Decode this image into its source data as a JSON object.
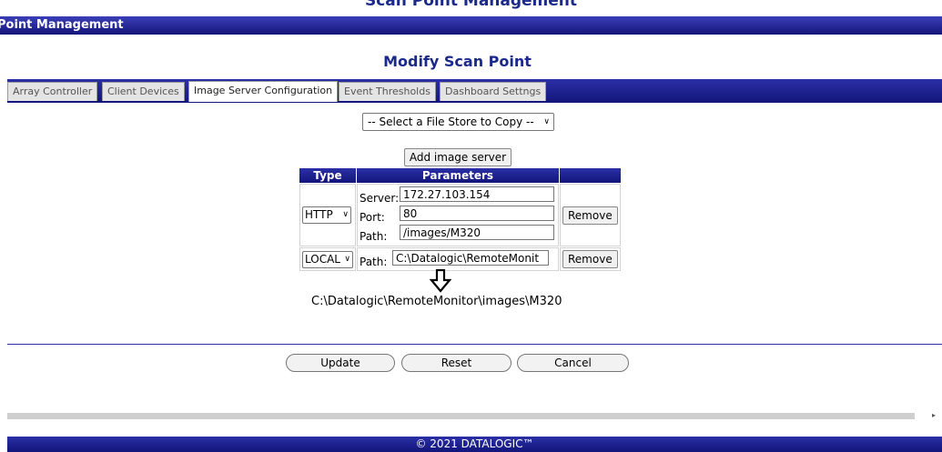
{
  "app_title": "Scan Point Management",
  "header": {
    "title": "Point Management"
  },
  "page_title": "Modify Scan Point",
  "tabs": [
    {
      "label": "Array Controller",
      "active": false
    },
    {
      "label": "Client Devices",
      "active": false
    },
    {
      "label": "Image Server Configuration",
      "active": true
    },
    {
      "label": "Event Thresholds",
      "active": false
    },
    {
      "label": "Dashboard Settngs",
      "active": false
    }
  ],
  "copy_select": {
    "selected": "-- Select a File Store to Copy --"
  },
  "add_button": "Add image server",
  "table": {
    "headers": [
      "Type",
      "Parameters",
      ""
    ],
    "rows": [
      {
        "type": "HTTP",
        "server_label": "Server:",
        "server_value": "172.27.103.154",
        "port_label": "Port:",
        "port_value": "80",
        "path_label": "Path:",
        "path_value": "/images/M320",
        "remove": "Remove"
      },
      {
        "type": "LOCAL",
        "path_label": "Path:",
        "path_value": "C:\\Datalogic\\RemoteMonit",
        "remove": "Remove"
      }
    ]
  },
  "resolved_path": "C:\\Datalogic\\RemoteMonitor\\images\\M320",
  "actions": {
    "update": "Update",
    "reset": "Reset",
    "cancel": "Cancel"
  },
  "footer": "© 2021 DATALOGIC™",
  "colors": {
    "brand_blue": "#1b2a8a",
    "bar_top": "#2b30a6",
    "bar_bottom": "#12157a"
  }
}
